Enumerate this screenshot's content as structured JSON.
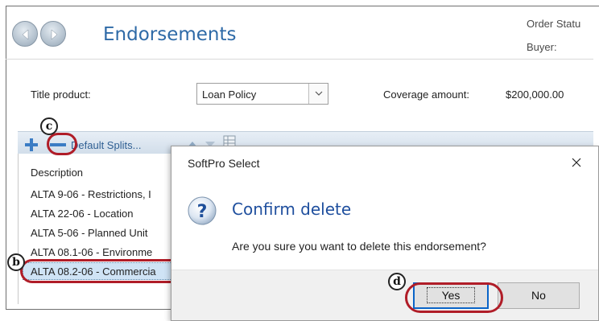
{
  "header": {
    "title": "Endorsements",
    "order_status_label": "Order Statu",
    "buyer_label": "Buyer:"
  },
  "form": {
    "title_product_label": "Title product:",
    "title_product_value": "Loan Policy",
    "coverage_label": "Coverage amount:",
    "coverage_value": "$200,000.00"
  },
  "grid": {
    "toolbar": {
      "default_splits_label": "Default Splits..."
    },
    "column_description": "Description",
    "rows": [
      "ALTA 9-06 - Restrictions, I",
      "ALTA 22-06 - Location",
      "ALTA 5-06 - Planned Unit",
      "ALTA 08.1-06 - Environme",
      "ALTA 08.2-06 - Commercia"
    ]
  },
  "dialog": {
    "title": "SoftPro Select",
    "heading": "Confirm delete",
    "message": "Are you sure you want to delete this endorsement?",
    "yes_label": "Yes",
    "no_label": "No"
  },
  "annotations": {
    "c": "c",
    "b": "b",
    "d": "d"
  },
  "colors": {
    "accent": "#2e6aa7",
    "callout": "#b01d28",
    "selection": "#cfe3f5"
  },
  "icons": [
    "back-arrow-icon",
    "forward-arrow-icon",
    "plus-icon",
    "minus-icon",
    "arrow-up-icon",
    "arrow-down-icon",
    "grid-icon",
    "question-icon",
    "close-icon",
    "chevron-down-icon"
  ]
}
